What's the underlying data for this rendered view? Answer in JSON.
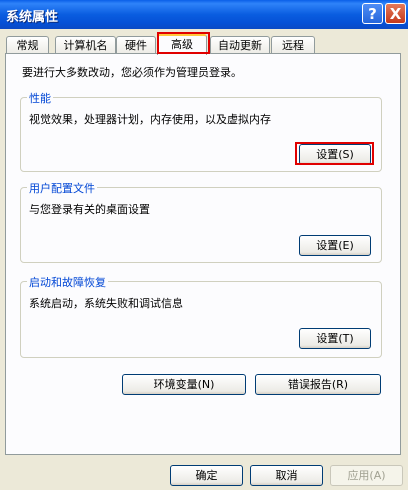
{
  "window": {
    "title": "系统属性"
  },
  "titlebar_buttons": {
    "help": "?",
    "close": "X"
  },
  "tabs": [
    {
      "label": "常规"
    },
    {
      "label": "计算机名"
    },
    {
      "label": "硬件"
    },
    {
      "label": "高级"
    },
    {
      "label": "自动更新"
    },
    {
      "label": "远程"
    }
  ],
  "active_tab": "高级",
  "admin_note": "要进行大多数改动，您必须作为管理员登录。",
  "groups": {
    "performance": {
      "title": "性能",
      "description": "视觉效果，处理器计划，内存使用，以及虚拟内存",
      "button": "设置(S)"
    },
    "user_profiles": {
      "title": "用户配置文件",
      "description": "与您登录有关的桌面设置",
      "button": "设置(E)"
    },
    "startup_recovery": {
      "title": "启动和故障恢复",
      "description": "系统启动，系统失败和调试信息",
      "button": "设置(T)"
    }
  },
  "env_button": "环境变量(N)",
  "error_report_button": "错误报告(R)",
  "footer": {
    "ok": "确定",
    "cancel": "取消",
    "apply": "应用(A)"
  }
}
